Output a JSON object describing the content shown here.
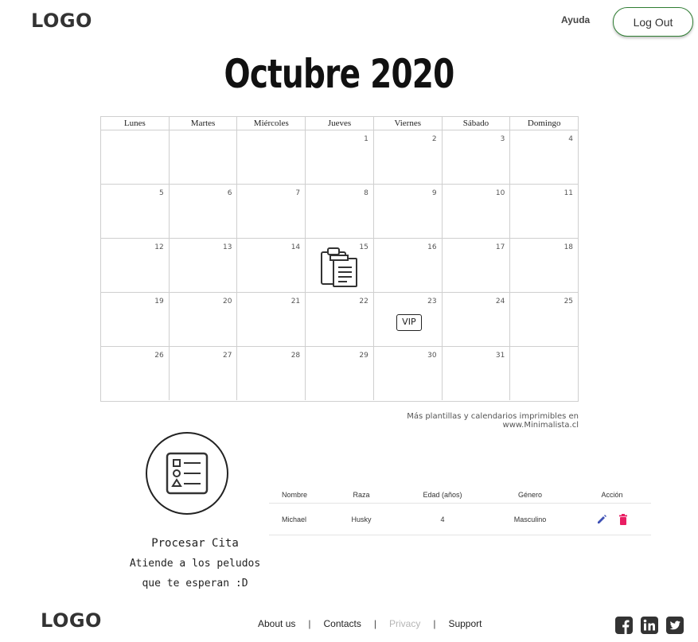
{
  "header": {
    "logo": "LOGO",
    "help_link": "Ayuda",
    "logout_button": "Log Out"
  },
  "calendar": {
    "title": "Octubre 2020",
    "weekdays": [
      "Lunes",
      "Martes",
      "Miércoles",
      "Jueves",
      "Viernes",
      "Sábado",
      "Domingo"
    ],
    "weeks": [
      [
        "",
        "",
        "",
        "1",
        "2",
        "3",
        "4"
      ],
      [
        "5",
        "6",
        "7",
        "8",
        "9",
        "10",
        "11"
      ],
      [
        "12",
        "13",
        "14",
        "15",
        "16",
        "17",
        "18"
      ],
      [
        "19",
        "20",
        "21",
        "22",
        "23",
        "24",
        "25"
      ],
      [
        "26",
        "27",
        "28",
        "29",
        "30",
        "31",
        ""
      ]
    ],
    "vip_badge": "VIP",
    "credit": "Más plantillas y calendarios imprimibles en www.Minimalista.cl"
  },
  "process": {
    "title": "Procesar Cita",
    "subtitle_line1": "Atiende a los peludos",
    "subtitle_line2": "que te esperan :D",
    "icon": "form-list-icon"
  },
  "table": {
    "headers": [
      "Nombre",
      "Raza",
      "Edad (años)",
      "Género",
      "Acción"
    ],
    "rows": [
      {
        "name": "Michael",
        "breed": "Husky",
        "age": "4",
        "gender": "Masculino"
      }
    ],
    "edit_color": "#3f51b5",
    "delete_color": "#e91e63"
  },
  "footer": {
    "logo": "LOGO",
    "links": [
      "About us",
      "Contacts",
      "Privacy",
      "Support"
    ],
    "separator": "|",
    "social_icons": [
      "facebook-icon",
      "linkedin-icon",
      "twitter-icon"
    ]
  }
}
